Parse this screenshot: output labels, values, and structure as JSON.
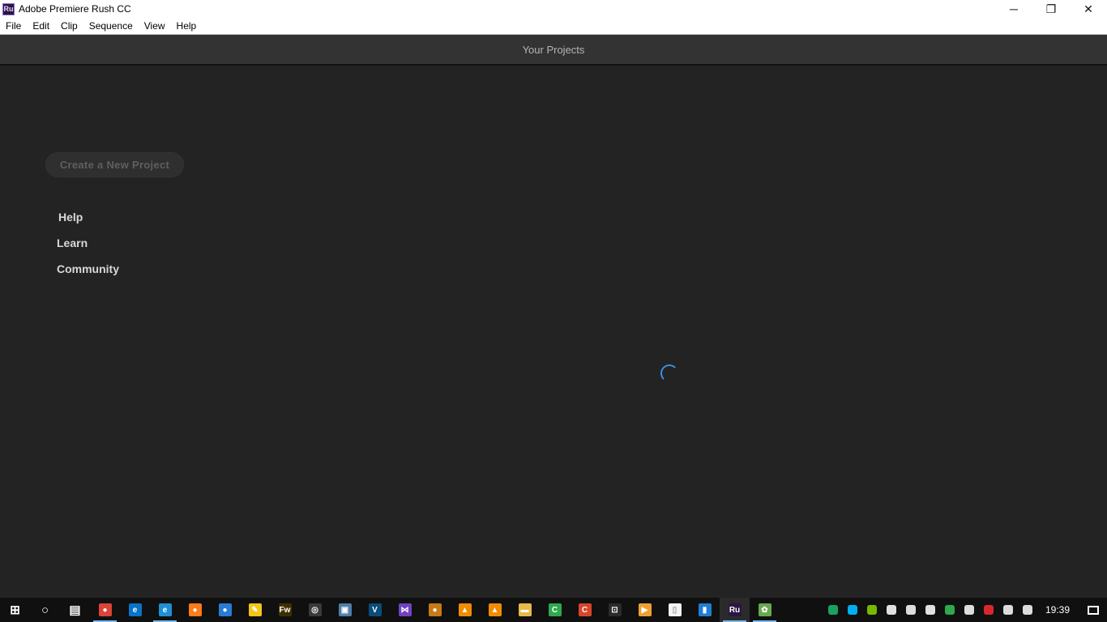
{
  "window": {
    "app_icon_text": "Ru",
    "title": "Adobe Premiere Rush CC",
    "controls": {
      "minimize": "─",
      "restore": "❐",
      "close": "✕"
    }
  },
  "menu": [
    "File",
    "Edit",
    "Clip",
    "Sequence",
    "View",
    "Help"
  ],
  "header": {
    "title": "Your Projects"
  },
  "sidebar": {
    "new_project_label": "Create a New Project",
    "links": [
      "Help",
      "Learn",
      "Community"
    ]
  },
  "loading": {
    "spinner_color": "#3a8fe0"
  },
  "taskbar": {
    "apps": [
      {
        "name": "start",
        "glyph": "⊞",
        "color": "#101010"
      },
      {
        "name": "search",
        "glyph": "○",
        "color": "#101010"
      },
      {
        "name": "task-view",
        "glyph": "▤",
        "color": "#101010"
      },
      {
        "name": "chrome",
        "glyph": "●",
        "color": "#db4437"
      },
      {
        "name": "edge",
        "glyph": "e",
        "color": "#0a73c9"
      },
      {
        "name": "internet-explorer",
        "glyph": "e",
        "color": "#1e90d6"
      },
      {
        "name": "firefox",
        "glyph": "●",
        "color": "#ff7a18"
      },
      {
        "name": "thunderbird",
        "glyph": "●",
        "color": "#2a7bd5"
      },
      {
        "name": "marker",
        "glyph": "✎",
        "color": "#f5c518"
      },
      {
        "name": "fireworks",
        "glyph": "Fw",
        "color": "#3d3000"
      },
      {
        "name": "obs",
        "glyph": "◎",
        "color": "#3a3a3a"
      },
      {
        "name": "remote-desktop",
        "glyph": "▣",
        "color": "#4f7ea8"
      },
      {
        "name": "vegas",
        "glyph": "V",
        "color": "#0a4c7a"
      },
      {
        "name": "visual-studio",
        "glyph": "⋈",
        "color": "#6f42c1"
      },
      {
        "name": "fl-studio",
        "glyph": "●",
        "color": "#c77a16"
      },
      {
        "name": "vlc",
        "glyph": "▲",
        "color": "#f08c00"
      },
      {
        "name": "vlc-2",
        "glyph": "▲",
        "color": "#f08c00"
      },
      {
        "name": "file-explorer",
        "glyph": "▬",
        "color": "#e8b94a"
      },
      {
        "name": "camtasia",
        "glyph": "C",
        "color": "#2fa84f"
      },
      {
        "name": "camtasia-recorder",
        "glyph": "C",
        "color": "#d9452b"
      },
      {
        "name": "store",
        "glyph": "⊡",
        "color": "#2b2b2b"
      },
      {
        "name": "media-player",
        "glyph": "▶",
        "color": "#f0a030"
      },
      {
        "name": "document",
        "glyph": "▯",
        "color": "#f4f4f4"
      },
      {
        "name": "notepad",
        "glyph": "▮",
        "color": "#1e7ed4"
      },
      {
        "name": "premiere-rush",
        "glyph": "Ru",
        "color": "#2b1640"
      },
      {
        "name": "paint",
        "glyph": "✿",
        "color": "#6aa84f"
      }
    ],
    "tray": [
      {
        "name": "hangouts",
        "color": "#1aa260"
      },
      {
        "name": "skype",
        "color": "#00aff0"
      },
      {
        "name": "nvidia",
        "color": "#76b900"
      },
      {
        "name": "cloud",
        "color": "#e0e0e0"
      },
      {
        "name": "network-display",
        "color": "#dcdcdc"
      },
      {
        "name": "defender",
        "color": "#e0e0e0"
      },
      {
        "name": "qbittorrent",
        "color": "#2fa84f"
      },
      {
        "name": "link",
        "color": "#dcdcdc"
      },
      {
        "name": "mega",
        "color": "#d9272e"
      },
      {
        "name": "volume",
        "color": "#dcdcdc"
      },
      {
        "name": "pen",
        "color": "#dcdcdc"
      }
    ],
    "clock": "19:39"
  }
}
